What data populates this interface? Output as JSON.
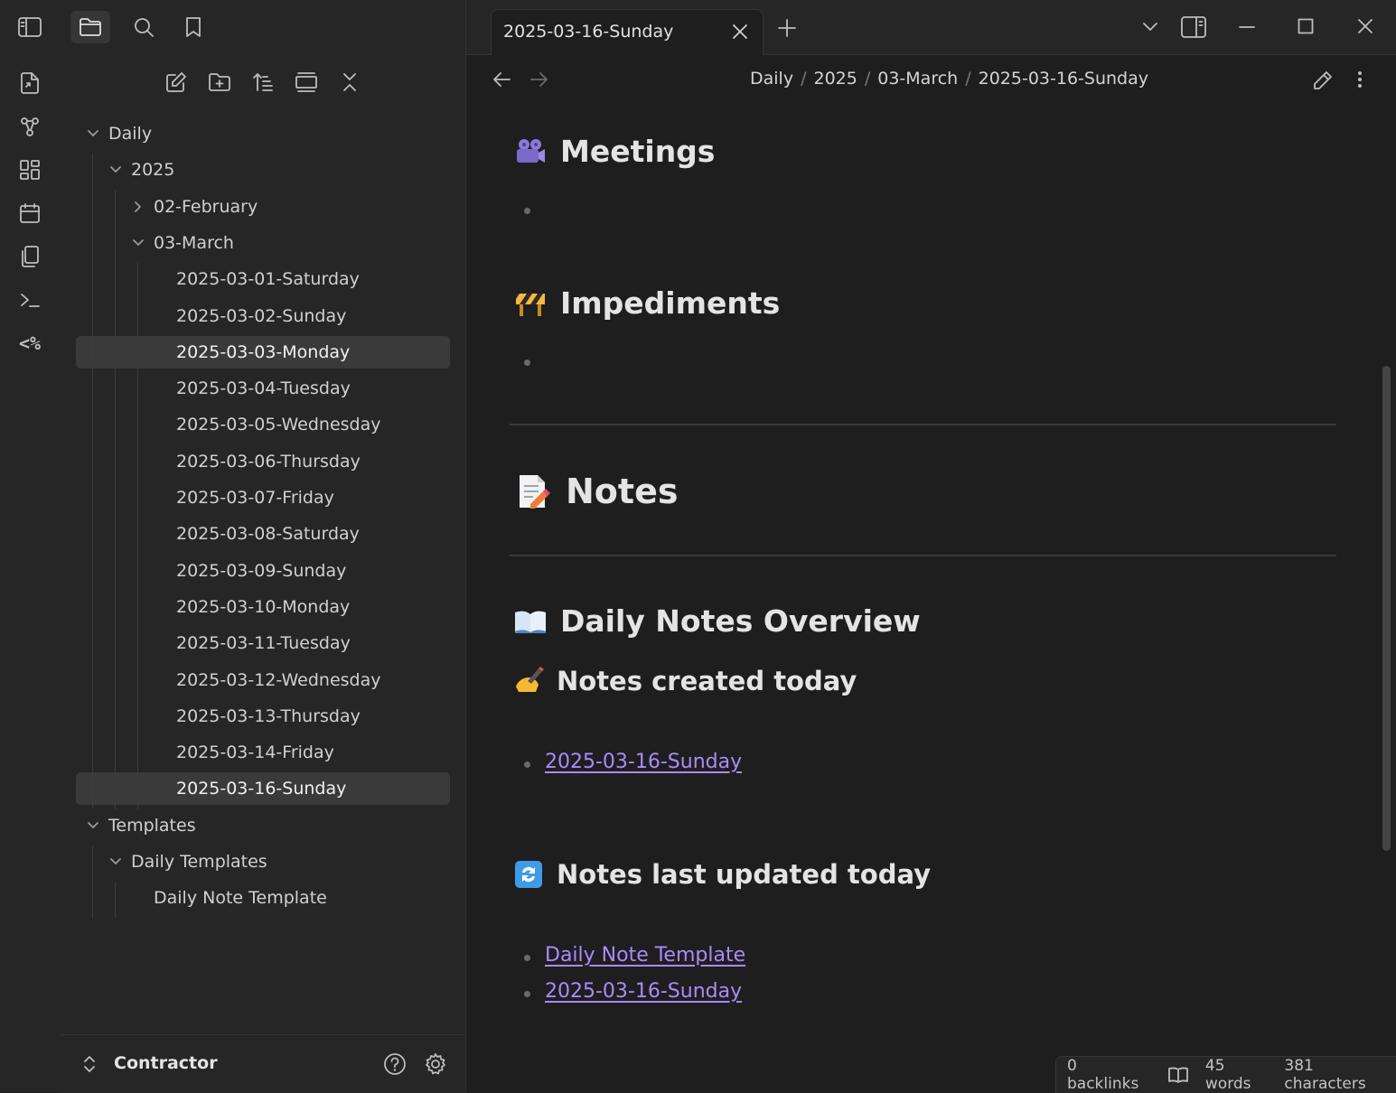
{
  "ribbon": {
    "icons": [
      "sidebar-toggle-icon",
      "open-quick-switcher-icon",
      "graph-view-icon",
      "canvas-icon",
      "calendar-icon",
      "copy-icon",
      "terminal-icon",
      "templater-icon"
    ]
  },
  "sidebar": {
    "tree": [
      {
        "label": "Daily",
        "level": 0,
        "chevron": "down"
      },
      {
        "label": "2025",
        "level": 1,
        "chevron": "down"
      },
      {
        "label": "02-February",
        "level": 2,
        "chevron": "right"
      },
      {
        "label": "03-March",
        "level": 2,
        "chevron": "down"
      },
      {
        "label": "2025-03-01-Saturday",
        "level": 3
      },
      {
        "label": "2025-03-02-Sunday",
        "level": 3
      },
      {
        "label": "2025-03-03-Monday",
        "level": 3,
        "selected": true
      },
      {
        "label": "2025-03-04-Tuesday",
        "level": 3
      },
      {
        "label": "2025-03-05-Wednesday",
        "level": 3
      },
      {
        "label": "2025-03-06-Thursday",
        "level": 3
      },
      {
        "label": "2025-03-07-Friday",
        "level": 3
      },
      {
        "label": "2025-03-08-Saturday",
        "level": 3
      },
      {
        "label": "2025-03-09-Sunday",
        "level": 3
      },
      {
        "label": "2025-03-10-Monday",
        "level": 3
      },
      {
        "label": "2025-03-11-Tuesday",
        "level": 3
      },
      {
        "label": "2025-03-12-Wednesday",
        "level": 3
      },
      {
        "label": "2025-03-13-Thursday",
        "level": 3
      },
      {
        "label": "2025-03-14-Friday",
        "level": 3
      },
      {
        "label": "2025-03-16-Sunday",
        "level": 3,
        "selected": true
      },
      {
        "label": "Templates",
        "level": 0,
        "chevron": "down"
      },
      {
        "label": "Daily Templates",
        "level": 1,
        "chevron": "down"
      },
      {
        "label": "Daily Note Template",
        "level": 2
      }
    ],
    "vault_name": "Contractor"
  },
  "tab": {
    "title": "2025-03-16-Sunday"
  },
  "breadcrumb": {
    "parts": [
      "Daily",
      "2025",
      "03-March",
      "2025-03-16-Sunday"
    ],
    "separator": "/"
  },
  "content": {
    "meetings": "Meetings",
    "impediments": "Impediments",
    "notes": "Notes",
    "overview": "Daily Notes Overview",
    "created_today": "Notes created today",
    "created_links": [
      "2025-03-16-Sunday"
    ],
    "updated_today": "Notes last updated today",
    "updated_links": [
      "Daily Note Template",
      "2025-03-16-Sunday"
    ]
  },
  "status": {
    "backlinks": "0 backlinks",
    "words": "45 words",
    "characters": "381 characters"
  },
  "colors": {
    "accent_link": "#a88bfa",
    "background": "#1e1e1e",
    "panel": "#262626"
  }
}
